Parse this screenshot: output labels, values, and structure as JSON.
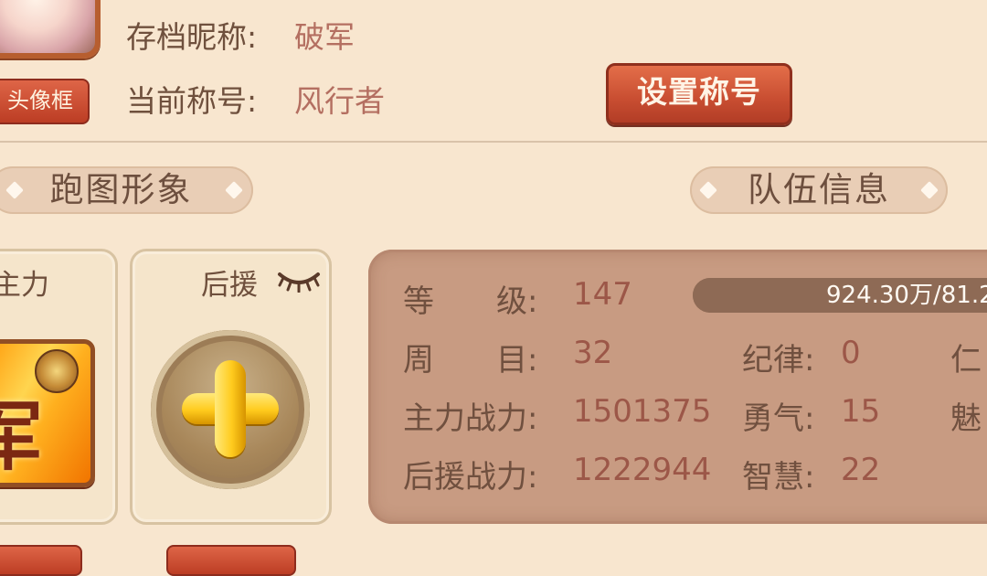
{
  "profile": {
    "frame_button_label": "头像框",
    "save_name_label": "存档昵称:",
    "save_name_value": "破军",
    "title_label": "当前称号:",
    "title_value": "风行者",
    "set_title_button": "设置称号"
  },
  "sections": {
    "appearance_title": "跑图形象",
    "team_title": "队伍信息"
  },
  "cards": {
    "main_label": "主力",
    "main_avatar_text": "军",
    "support_label": "后援"
  },
  "team_info": {
    "level_label": "等　　级:",
    "level_value": "147",
    "exp_text": "924.30万/81.2",
    "round_label": "周　　目:",
    "round_value": "32",
    "main_power_label": "主力战力:",
    "main_power_value": "1501375",
    "support_power_label": "后援战力:",
    "support_power_value": "1222944",
    "discipline_label": "纪律:",
    "discipline_value": "0",
    "courage_label": "勇气:",
    "courage_value": "15",
    "wisdom_label": "智慧:",
    "wisdom_value": "22",
    "benevolence_label_partial": "仁",
    "charm_label_partial": "魅"
  },
  "colors": {
    "accent_red": "#c84d31",
    "panel_bg": "#c89b82",
    "page_bg": "#f8e6cf"
  }
}
